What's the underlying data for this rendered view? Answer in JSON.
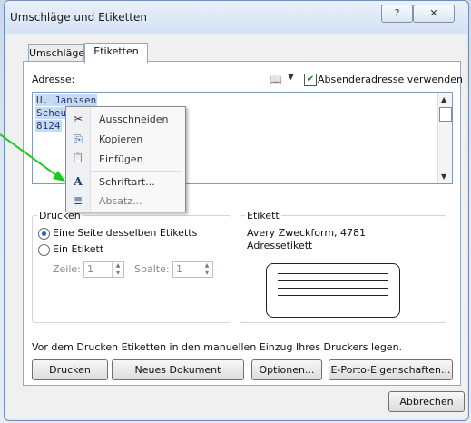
{
  "window": {
    "title": "Umschläge und Etiketten",
    "help_label": "?",
    "close_label": "✕"
  },
  "tabs": [
    {
      "label": "Umschläge",
      "active": false
    },
    {
      "label": "Etiketten",
      "active": true
    }
  ],
  "address": {
    "label": "Adresse:",
    "use_return_label": "Absenderadresse verwenden",
    "use_return_checked": true,
    "lines": [
      "U. Janssen",
      "Scheu",
      "8124"
    ]
  },
  "context_menu": {
    "items": [
      {
        "label": "Ausschneiden",
        "icon": "scissors-icon",
        "glyph": "✂",
        "disabled": false
      },
      {
        "label": "Kopieren",
        "icon": "copy-icon",
        "glyph": "⎘",
        "disabled": false
      },
      {
        "label": "Einfügen",
        "icon": "paste-icon",
        "glyph": "📋",
        "disabled": false
      },
      {
        "label": "Schriftart...",
        "icon": "font-icon",
        "glyph": "A",
        "disabled": false
      },
      {
        "label": "Absatz...",
        "icon": "paragraph-icon",
        "glyph": "≣",
        "disabled": true
      }
    ]
  },
  "print_group": {
    "title": "Drucken",
    "option_full": "Eine Seite desselben Etiketts",
    "option_single": "Ein Etikett",
    "row_label": "Zeile:",
    "row_value": "1",
    "col_label": "Spalte:",
    "col_value": "1"
  },
  "label_group": {
    "title": "Etikett",
    "product": "Avery Zweckform, 4781",
    "type": "Adressetikett"
  },
  "hint": "Vor dem Drucken Etiketten in den manuellen Einzug Ihres Druckers legen.",
  "buttons": {
    "print": "Drucken",
    "new_document": "Neues Dokument",
    "options": "Optionen...",
    "postage": "E-Porto-Eigenschaften...",
    "cancel": "Abbrechen"
  },
  "colors": {
    "arrow": "#19c81d",
    "selection": "#c8d9f3"
  }
}
